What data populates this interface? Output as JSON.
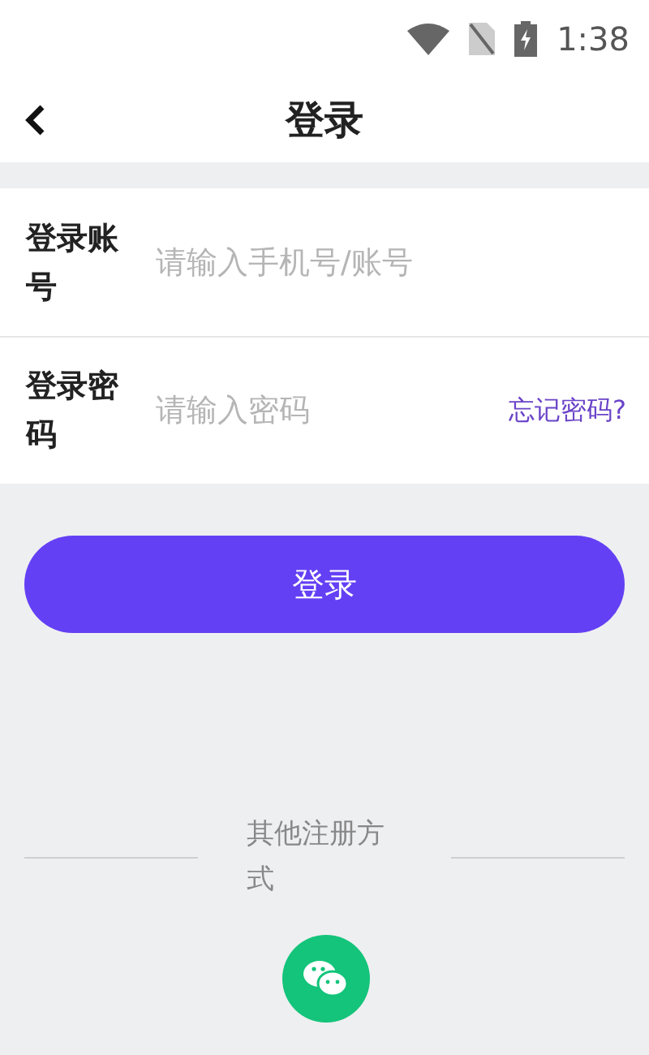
{
  "status_bar": {
    "time": "1:38"
  },
  "header": {
    "title": "登录"
  },
  "form": {
    "rows": [
      {
        "label": "登录账号",
        "placeholder": "请输入手机号/账号"
      },
      {
        "label": "登录密码",
        "placeholder": "请输入密码",
        "link": "忘记密码?"
      }
    ]
  },
  "login_button": "登录",
  "other": {
    "label": "其他注册方式"
  }
}
